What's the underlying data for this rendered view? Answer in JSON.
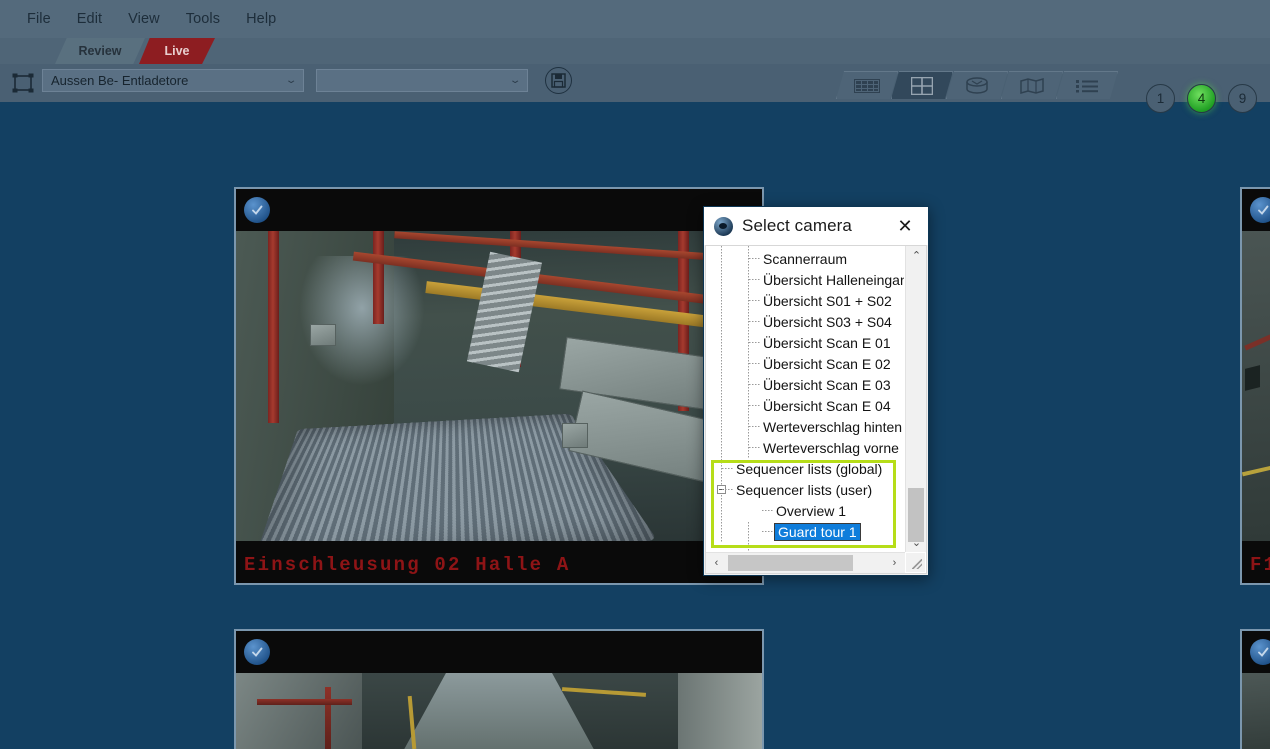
{
  "app": {
    "background_color": "#134062"
  },
  "menubar": {
    "items": [
      {
        "label": "File"
      },
      {
        "label": "Edit"
      },
      {
        "label": "View"
      },
      {
        "label": "Tools"
      },
      {
        "label": "Help"
      }
    ]
  },
  "tabs": {
    "review_label": "Review",
    "live_label": "Live",
    "active": "Live",
    "live_color": "#8d1d21"
  },
  "toolbar": {
    "layout_icon": "layout-frame-icon",
    "layout_select": {
      "value": "Aussen Be- Entladetore",
      "placeholder": "",
      "caret": "⌄"
    },
    "secondary_select": {
      "value": "",
      "placeholder": "",
      "caret": "⌄"
    },
    "save_button": {
      "icon": "floppy-disk-save-icon",
      "label": ""
    },
    "view_tabs": [
      {
        "icon": "filmstrip-icon",
        "name": "filmstrip",
        "active": false
      },
      {
        "icon": "grid-icon",
        "name": "grid",
        "active": true
      },
      {
        "icon": "database-icon",
        "name": "database",
        "active": false
      },
      {
        "icon": "map-icon",
        "name": "map",
        "active": false
      },
      {
        "icon": "list-icon",
        "name": "list",
        "active": false
      }
    ],
    "number_buttons": [
      {
        "label": "1",
        "active": false
      },
      {
        "label": "4",
        "active": true
      },
      {
        "label": "9",
        "active": false
      }
    ],
    "active_number_color": "#3fbe2f"
  },
  "video_grid": {
    "tiles": [
      {
        "name": "tile-einschleusung-02",
        "label": "Einschleusung 02 Halle A",
        "label_color": "#8e1416",
        "ptz_icon": "ptz-camera-icon"
      },
      {
        "name": "tile-lower-left",
        "label": "",
        "label_color": "#8e1416",
        "ptz_icon": "ptz-camera-icon"
      },
      {
        "name": "tile-right-edge-upper",
        "label": "F1",
        "label_color": "#8e1416",
        "ptz_icon": "ptz-camera-icon"
      },
      {
        "name": "tile-right-edge-lower",
        "label": "",
        "label_color": "#8e1416",
        "ptz_icon": "ptz-camera-icon"
      }
    ]
  },
  "dialog": {
    "title": "Select camera",
    "title_icon": "dome-camera-icon",
    "close_icon": "✕",
    "annotation_color": "#b6dd18",
    "selection_color": "#0f7ddb",
    "tree": [
      {
        "label": "Scannerraum",
        "level": 2,
        "expander": false,
        "selected": false
      },
      {
        "label": "Übersicht Halleneingang",
        "level": 2,
        "expander": false,
        "selected": false
      },
      {
        "label": "Übersicht S01 + S02",
        "level": 2,
        "expander": false,
        "selected": false
      },
      {
        "label": "Übersicht S03 + S04",
        "level": 2,
        "expander": false,
        "selected": false
      },
      {
        "label": "Übersicht Scan E 01",
        "level": 2,
        "expander": false,
        "selected": false
      },
      {
        "label": "Übersicht Scan E 02",
        "level": 2,
        "expander": false,
        "selected": false
      },
      {
        "label": "Übersicht Scan E 03",
        "level": 2,
        "expander": false,
        "selected": false
      },
      {
        "label": "Übersicht Scan E 04",
        "level": 2,
        "expander": false,
        "selected": false
      },
      {
        "label": "Werteverschlag hinten",
        "level": 2,
        "expander": false,
        "selected": false
      },
      {
        "label": "Werteverschlag vorne",
        "level": 2,
        "expander": false,
        "selected": false
      },
      {
        "label": "Sequencer lists (global)",
        "level": 1,
        "expander": false,
        "selected": false
      },
      {
        "label": "Sequencer lists (user)",
        "level": 1,
        "expander": true,
        "selected": false
      },
      {
        "label": "Overview 1",
        "level": 2,
        "expander": false,
        "selected": false
      },
      {
        "label": "Guard tour 1",
        "level": 2,
        "expander": false,
        "selected": true
      }
    ],
    "scrollbars": {
      "up_arrow": "⌃",
      "down_arrow": "⌄",
      "left_arrow": "‹",
      "right_arrow": "›"
    }
  }
}
